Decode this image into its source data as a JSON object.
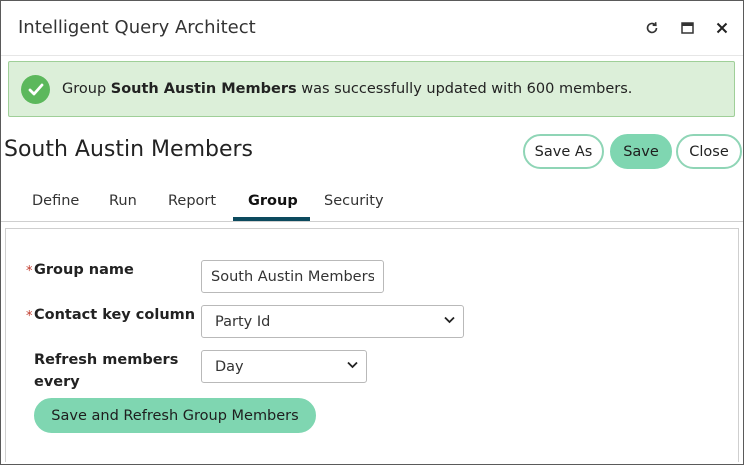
{
  "window": {
    "title": "Intelligent Query Architect",
    "controls": {
      "refresh_icon": "refresh-icon",
      "maximize_icon": "maximize-icon",
      "close_icon": "close-icon"
    }
  },
  "alert": {
    "icon": "check-circle-icon",
    "prefix": "Group",
    "group_name": "South Austin Members",
    "suffix": "was successfully updated with 600 members.",
    "color": "#dcefd9"
  },
  "header": {
    "title": "South Austin Members",
    "save_as_label": "Save As",
    "save_label": "Save",
    "close_label": "Close"
  },
  "tabs": [
    {
      "label": "Define"
    },
    {
      "label": "Run"
    },
    {
      "label": "Report"
    },
    {
      "label": "Group",
      "active": true
    },
    {
      "label": "Security"
    }
  ],
  "form": {
    "group_name": {
      "label": "Group name",
      "value": "South Austin Members"
    },
    "contact_key_column": {
      "label": "Contact key column",
      "value": "Party Id"
    },
    "refresh_every": {
      "label_line1": "Refresh members",
      "label_line2": "every",
      "value": "Day"
    },
    "submit_label": "Save and Refresh Group Members"
  },
  "colors": {
    "accent": "#7fd6b1",
    "tab_underline": "#0c4a5e",
    "required": "#c0392b"
  }
}
